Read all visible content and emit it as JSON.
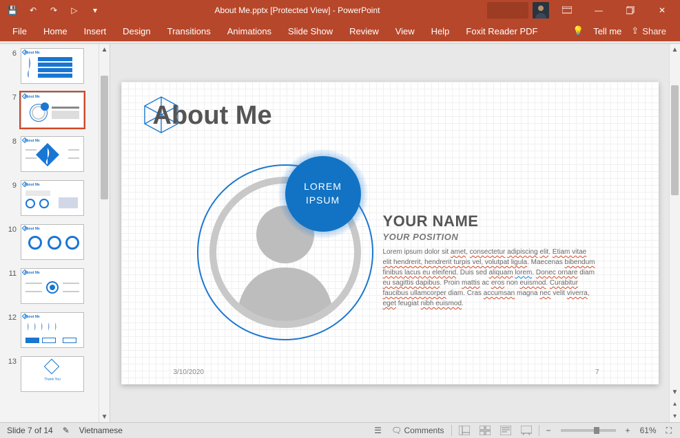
{
  "titlebar": {
    "doc_title": "About Me.pptx [Protected View]  -  PowerPoint"
  },
  "ribbon": {
    "tabs": [
      "File",
      "Home",
      "Insert",
      "Design",
      "Transitions",
      "Animations",
      "Slide Show",
      "Review",
      "View",
      "Help",
      "Foxit Reader PDF"
    ],
    "tell_me": "Tell me",
    "share": "Share"
  },
  "thumbnails": {
    "items": [
      {
        "n": "6"
      },
      {
        "n": "7"
      },
      {
        "n": "8"
      },
      {
        "n": "9"
      },
      {
        "n": "10"
      },
      {
        "n": "11"
      },
      {
        "n": "12"
      },
      {
        "n": "13"
      }
    ],
    "selected_index": 1
  },
  "slide": {
    "title": "About Me",
    "badge_line1": "LOREM",
    "badge_line2": "IPSUM",
    "name": "YOUR NAME",
    "position": "YOUR POSITION",
    "body_html": "Lorem ipsum dolor sit <span class='sp'>amet</span>, <span class='sp'>consectetur</span> <span class='sp'>adipiscing</span> <span class='sp'>elit</span>. <span class='sp'>Etiam vitae elit hendrerit, hendrerit turpis vel, volutpat ligula</span>. Maecenas <span class='sp'>bibendum finibus lacus eu eleifend</span>. Duis sed <span class='sp'>aliquam</span> <span class='gr'>lorem</span>. <span class='sp'>Donec ornare</span> diam <span class='sp'>eu sagittis dapibus</span>. Proin <span class='sp'>mattis</span> ac <span class='sp'>eros</span> non <span class='sp'>euismod</span>. <span class='sp'>Curabitur faucibus ullamcorper</span> diam. Cras <span class='sp'>accumsan</span> magna <span class='sp'>nec</span> velit <span class='sp'>viverra</span>, <span class='sp'>eget</span> feugiat <span class='sp'>nibh euismod</span>.",
    "date": "3/10/2020",
    "page_num": "7"
  },
  "statusbar": {
    "slide_info": "Slide 7 of 14",
    "language": "Vietnamese",
    "comments": "Comments",
    "zoom_pct": "61%"
  },
  "icons": {
    "save": "💾",
    "undo": "↶",
    "redo": "↷",
    "start": "▷",
    "ribbon_opts": "▾",
    "minimize": "—",
    "restore": "▭",
    "close": "✕",
    "lightbulb": "💡",
    "share": "⇪",
    "spell": "✎",
    "notes": "☰",
    "comments": "🗨",
    "fit": "⛶",
    "plus": "+",
    "minus": "−",
    "up": "▲",
    "down": "▼",
    "prev": "▴",
    "next": "▾"
  }
}
